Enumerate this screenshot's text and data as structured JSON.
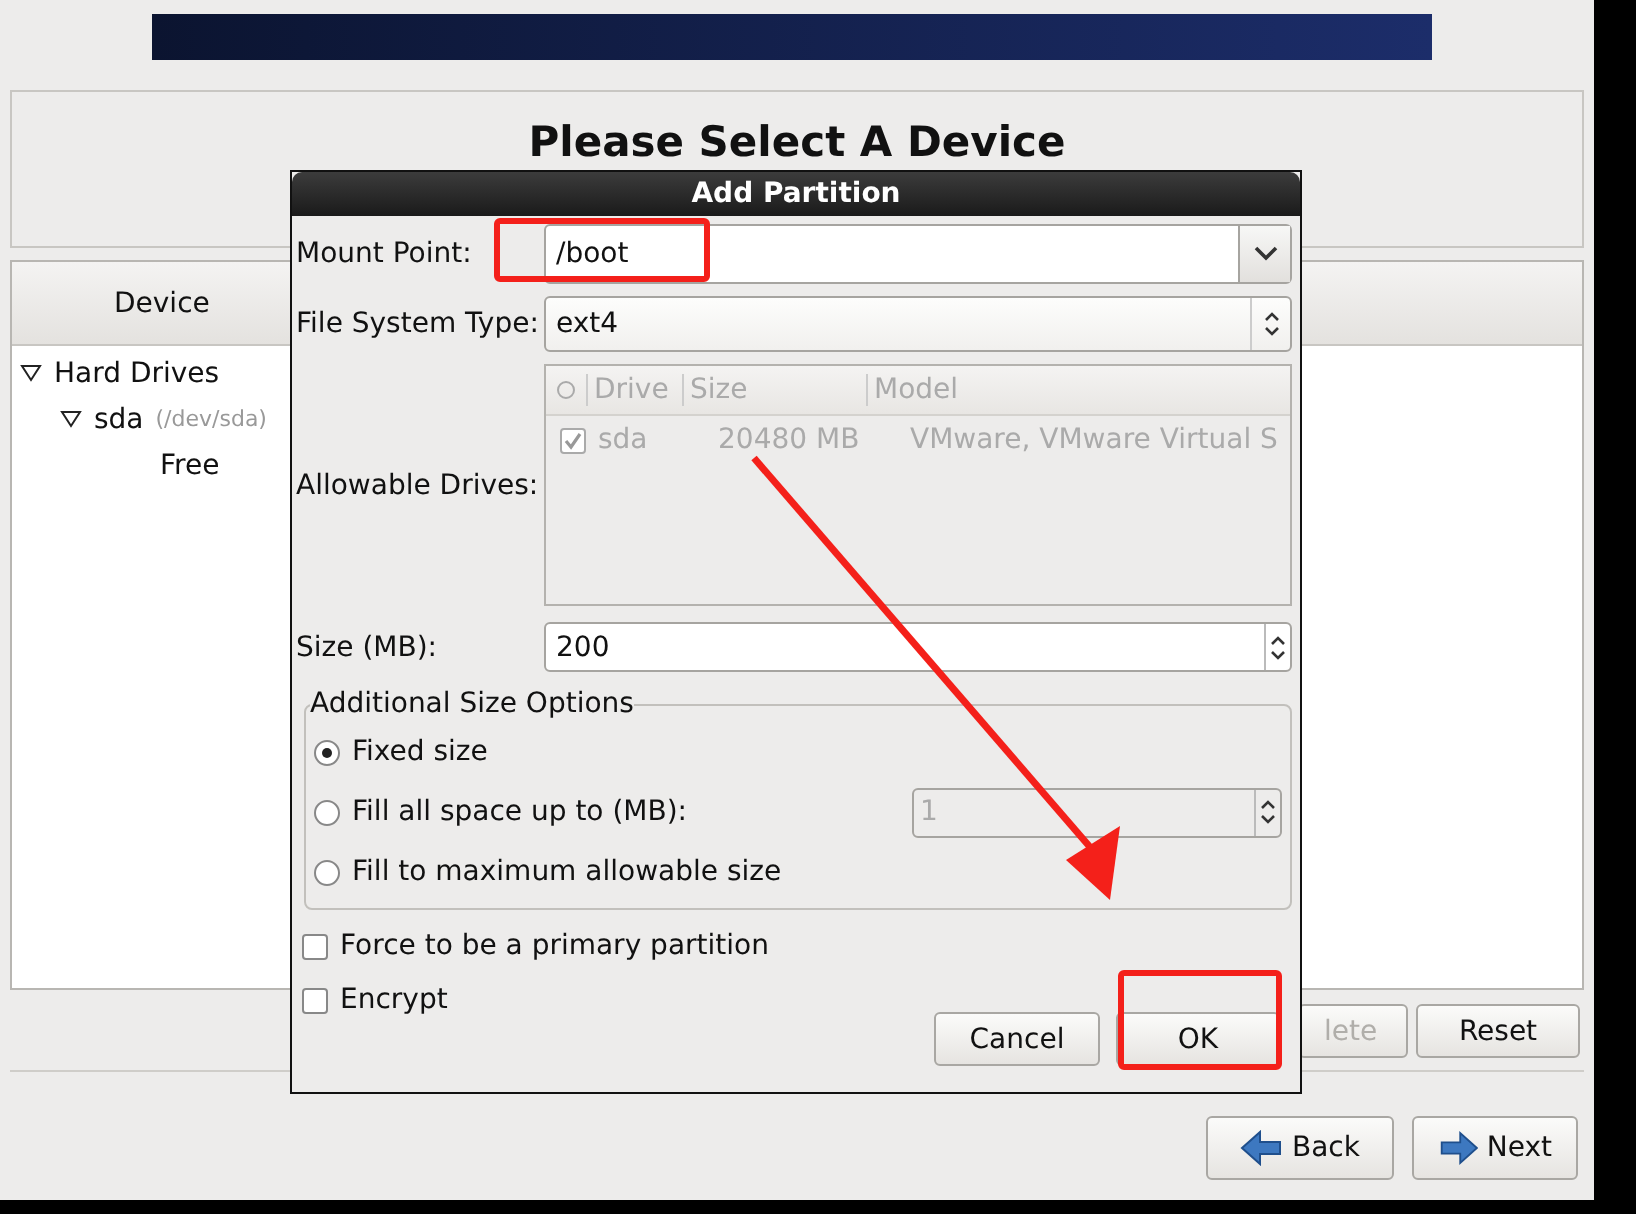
{
  "background": {
    "title": "Please Select A Device",
    "device_column": "Device",
    "tree": [
      {
        "label": "Hard Drives",
        "expanded": true,
        "children": [
          {
            "label": "sda",
            "detail": "(/dev/sda)",
            "expanded": true,
            "children": [
              {
                "label": "Free"
              }
            ]
          }
        ]
      }
    ],
    "buttons": [
      {
        "label": "lete",
        "disabled": true
      },
      {
        "label": "Reset",
        "disabled": false
      }
    ],
    "nav": [
      {
        "label": "Back",
        "kind": "back"
      },
      {
        "label": "Next",
        "kind": "next"
      }
    ]
  },
  "dialog": {
    "title": "Add Partition",
    "mount_point": {
      "label": "Mount Point:",
      "value": "/boot"
    },
    "fs_type": {
      "label": "File System Type:",
      "value": "ext4"
    },
    "drives": {
      "label": "Allowable Drives:",
      "disabled": true,
      "columns": [
        "Drive",
        "Size",
        "Model"
      ],
      "rows": [
        {
          "checked": true,
          "drive": "sda",
          "size": "20480 MB",
          "model": "VMware, VMware Virtual S"
        }
      ]
    },
    "size": {
      "label": "Size (MB):",
      "value": "200"
    },
    "size_options": {
      "title": "Additional Size Options",
      "options": [
        {
          "label": "Fixed size",
          "selected": true
        },
        {
          "label": "Fill all space up to (MB):",
          "selected": false,
          "value": "1"
        },
        {
          "label": "Fill to maximum allowable size",
          "selected": false
        }
      ]
    },
    "checkboxes": [
      {
        "label": "Force to be a primary partition",
        "checked": false
      },
      {
        "label": "Encrypt",
        "checked": false
      }
    ],
    "buttons": [
      {
        "label": "Cancel"
      },
      {
        "label": "OK"
      }
    ]
  }
}
